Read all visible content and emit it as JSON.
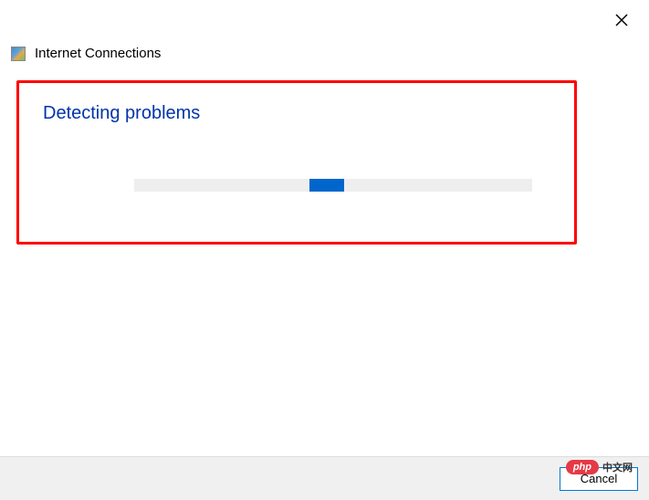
{
  "header": {
    "title": "Internet Connections"
  },
  "content": {
    "heading": "Detecting problems"
  },
  "footer": {
    "cancel_label": "Cancel"
  },
  "watermark": {
    "badge": "php",
    "text": "中文网"
  }
}
